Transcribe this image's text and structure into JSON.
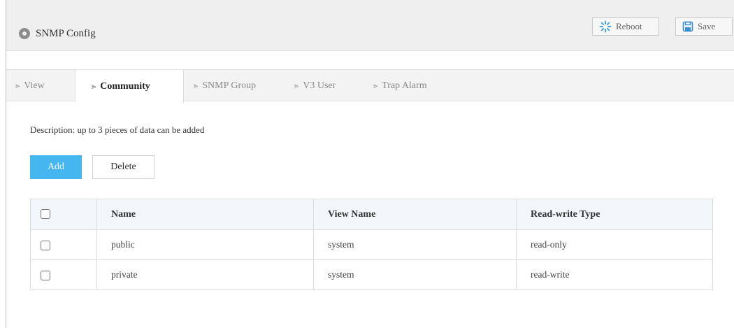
{
  "header": {
    "title": "SNMP Config",
    "reboot_label": "Reboot",
    "save_label": "Save"
  },
  "tabs": [
    {
      "label": "View",
      "active": false
    },
    {
      "label": "Community",
      "active": true
    },
    {
      "label": "SNMP Group",
      "active": false
    },
    {
      "label": "V3 User",
      "active": false
    },
    {
      "label": "Trap Alarm",
      "active": false
    }
  ],
  "description": "Description: up to 3 pieces of data can be added",
  "actions": {
    "add_label": "Add",
    "delete_label": "Delete"
  },
  "table": {
    "columns": [
      "Name",
      "View Name",
      "Read-write Type"
    ],
    "rows": [
      {
        "name": "public",
        "view_name": "system",
        "rw_type": "read-only"
      },
      {
        "name": "private",
        "view_name": "system",
        "rw_type": "read-write"
      }
    ]
  },
  "colors": {
    "accent": "#45b6f0",
    "header_bg": "#efefef",
    "table_header_bg": "#f3f7fb"
  }
}
